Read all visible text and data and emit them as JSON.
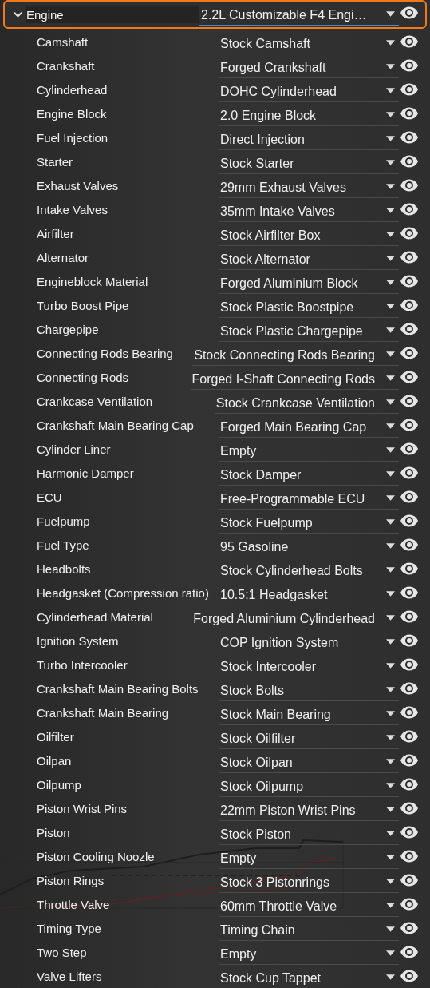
{
  "header": {
    "label": "Engine",
    "value": "2.2L Customizable F4 Engi…",
    "expanded": true,
    "highlighted": true
  },
  "parts": [
    {
      "label": "Camshaft",
      "value": "Stock Camshaft"
    },
    {
      "label": "Crankshaft",
      "value": "Forged Crankshaft"
    },
    {
      "label": "Cylinderhead",
      "value": "DOHC Cylinderhead"
    },
    {
      "label": "Engine Block",
      "value": "2.0 Engine Block"
    },
    {
      "label": "Fuel Injection",
      "value": "Direct Injection"
    },
    {
      "label": "Starter",
      "value": "Stock Starter"
    },
    {
      "label": "Exhaust Valves",
      "value": "29mm Exhaust Valves"
    },
    {
      "label": "Intake Valves",
      "value": "35mm Intake Valves"
    },
    {
      "label": "Airfilter",
      "value": "Stock Airfilter Box"
    },
    {
      "label": "Alternator",
      "value": "Stock Alternator"
    },
    {
      "label": "Engineblock Material",
      "value": "Forged Aluminium Block"
    },
    {
      "label": "Turbo Boost Pipe",
      "value": "Stock Plastic Boostpipe"
    },
    {
      "label": "Chargepipe",
      "value": "Stock Plastic Chargepipe"
    },
    {
      "label": "Connecting Rods Bearing",
      "value": "Stock Connecting Rods Bearing"
    },
    {
      "label": "Connecting Rods",
      "value": "Forged I-Shaft Connecting Rods"
    },
    {
      "label": "Crankcase Ventilation",
      "value": "Stock Crankcase Ventilation"
    },
    {
      "label": "Crankshaft Main Bearing Cap",
      "value": "Forged Main Bearing Cap"
    },
    {
      "label": "Cylinder Liner",
      "value": "Empty"
    },
    {
      "label": "Harmonic Damper",
      "value": "Stock Damper"
    },
    {
      "label": "ECU",
      "value": "Free-Programmable ECU"
    },
    {
      "label": "Fuelpump",
      "value": "Stock Fuelpump"
    },
    {
      "label": "Fuel Type",
      "value": "95 Gasoline"
    },
    {
      "label": "Headbolts",
      "value": "Stock Cylinderhead Bolts"
    },
    {
      "label": "Headgasket (Compression ratio)",
      "value": "10.5:1 Headgasket"
    },
    {
      "label": "Cylinderhead Material",
      "value": "Forged Aluminium Cylinderhead"
    },
    {
      "label": "Ignition System",
      "value": "COP Ignition System"
    },
    {
      "label": "Turbo Intercooler",
      "value": "Stock Intercooler"
    },
    {
      "label": "Crankshaft Main Bearing Bolts",
      "value": "Stock Bolts"
    },
    {
      "label": "Crankshaft Main Bearing",
      "value": "Stock Main Bearing"
    },
    {
      "label": "Oilfilter",
      "value": "Stock Oilfilter"
    },
    {
      "label": "Oilpan",
      "value": "Stock Oilpan"
    },
    {
      "label": "Oilpump",
      "value": "Stock Oilpump"
    },
    {
      "label": "Piston Wrist Pins",
      "value": "22mm Piston Wrist Pins"
    },
    {
      "label": "Piston",
      "value": "Stock Piston"
    },
    {
      "label": "Piston Cooling Noozle",
      "value": "Empty"
    },
    {
      "label": "Piston Rings",
      "value": "Stock 3 Pistonrings"
    },
    {
      "label": "Throttle Valve",
      "value": "60mm Throttle Valve"
    },
    {
      "label": "Timing Type",
      "value": "Timing Chain"
    },
    {
      "label": "Two Step",
      "value": "Empty"
    },
    {
      "label": "Valve Lifters",
      "value": "Stock Cup Tappet"
    }
  ]
}
